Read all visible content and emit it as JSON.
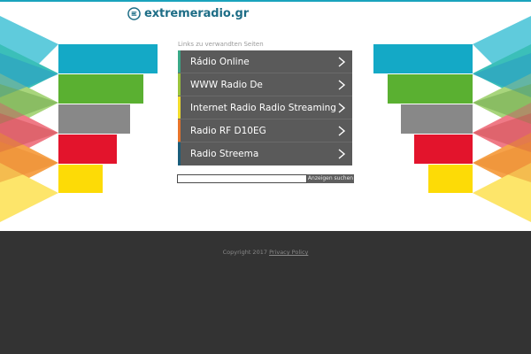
{
  "header": {
    "logo_text": "extremeradio.gr",
    "brand_color": "#1d6d86"
  },
  "links": {
    "caption": "Links zu verwandten Seiten",
    "items": [
      {
        "label": "Rádio Online",
        "accent": "#3aa887"
      },
      {
        "label": "WWW Radio De",
        "accent": "#9ac33c"
      },
      {
        "label": "Internet Radio Radio Streaming",
        "accent": "#f2dd2c"
      },
      {
        "label": "Radio RF D10EG",
        "accent": "#e8742a"
      },
      {
        "label": "Radio Streema",
        "accent": "#1a5d7a"
      }
    ]
  },
  "search": {
    "value": "",
    "button_label": "Anzeigen suchen"
  },
  "footer": {
    "copyright": "Copyright 2017",
    "privacy_label": "Privacy Policy"
  },
  "colors": {
    "stripe_cyan": "#14a9c6",
    "stripe_green": "#5ab031",
    "stripe_gray": "#888888",
    "stripe_red": "#e3142c",
    "stripe_yellow": "#fddb06",
    "footer_bg": "#333333"
  }
}
